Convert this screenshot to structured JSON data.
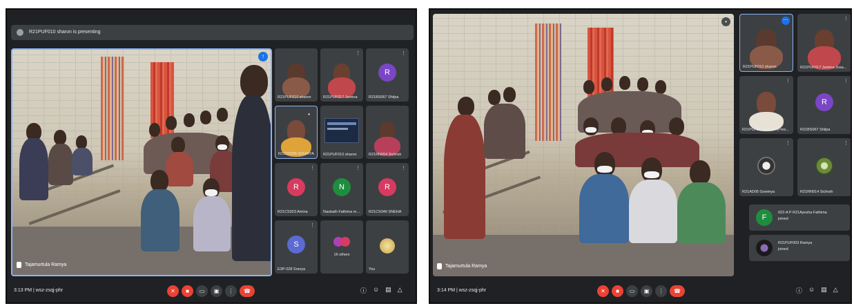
{
  "left": {
    "presenting_banner": "R21PUF010 sharon is presenting",
    "main_speaker": "Tajamurtula Ramya",
    "tiles": [
      {
        "label": "R21PUF010 sharon",
        "type": "photo"
      },
      {
        "label": "R21PUF017 Jamina",
        "type": "photo"
      },
      {
        "label": "R21BS067 Shilpa",
        "type": "avatar",
        "letter": "R",
        "color": "#7b46c6"
      },
      {
        "label": "R21DS005 SOUMYA",
        "type": "photo"
      },
      {
        "label": "R21PUF010 sharon",
        "type": "screen"
      },
      {
        "label": "R21RN004 Sichrah",
        "type": "photo"
      },
      {
        "label": "R21CS023 Amina",
        "type": "avatar",
        "letter": "R",
        "color": "#d93a5f"
      },
      {
        "label": "Naubath Fathima mohi...",
        "type": "avatar",
        "letter": "N",
        "color": "#1e8e3e"
      },
      {
        "label": "R21CS046 SNEHA",
        "type": "avatar",
        "letter": "R",
        "color": "#d93a5f"
      },
      {
        "label": "E3P-028 Sravya",
        "type": "avatar",
        "letter": "S",
        "color": "#5b6bd1"
      },
      {
        "label": "16 others",
        "type": "others"
      },
      {
        "label": "You",
        "type": "photo"
      }
    ],
    "time_code": "3:13 PM  |  wsz-zsqj-phr"
  },
  "right": {
    "main_speaker": "Tajamurtula Ramya",
    "tiles": [
      {
        "label": "R21PUF010 sharon",
        "type": "photo"
      },
      {
        "label": "R21PUF017 Jamina Josa...",
        "type": "photo"
      },
      {
        "label": "R21PUF010 sharon (Pres...",
        "type": "photo"
      },
      {
        "label": "R21BS067 Shilpa",
        "type": "avatar",
        "letter": "R",
        "color": "#7b46c6"
      },
      {
        "label": "R21AD05 Gowmya",
        "type": "photo"
      },
      {
        "label": "R21RN014 Sichrah",
        "type": "photo"
      }
    ],
    "toasts": [
      {
        "letter": "F",
        "color": "#1e8e3e",
        "line1": "022-A P R21Ayesha Fathima",
        "line2": "joined"
      },
      {
        "letter": "",
        "color": "#222",
        "line1": "R21PUF003 Ramya",
        "line2": "joined"
      }
    ],
    "time_code": "3:14 PM  |  wsz-zsqj-phr"
  },
  "icons": {
    "mic_off": "mic-off-icon",
    "cam_off": "camera-off-icon",
    "captions": "captions-icon",
    "present": "present-icon",
    "more": "more-options-icon",
    "end_call": "end-call-icon",
    "info": "info-icon",
    "people": "people-icon",
    "chat": "chat-icon",
    "activities": "activities-icon"
  },
  "colors": {
    "meet_bg": "#202124",
    "tile_bg": "#3c4043",
    "end_red": "#ea4335",
    "accent_blue": "#1a73e8"
  }
}
